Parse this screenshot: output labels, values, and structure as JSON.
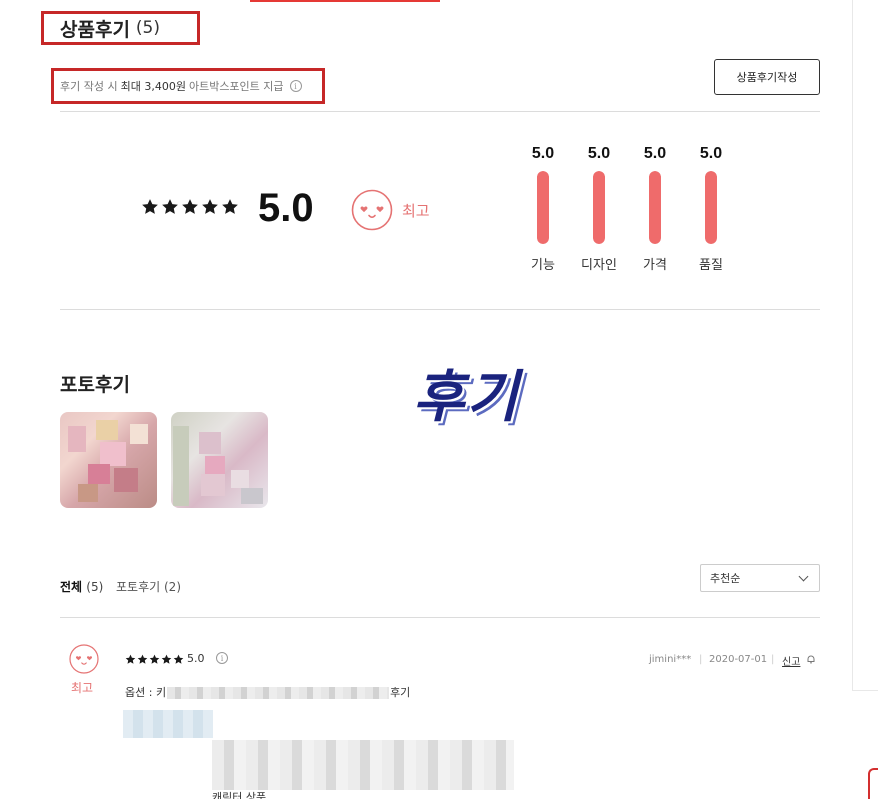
{
  "header": {
    "title": "상품후기",
    "count": "(5)",
    "notice_prefix": "후기 작성 시",
    "notice_strong": "최대 3,400원",
    "notice_suffix": "아트박스포인트 지급",
    "info_icon": "i",
    "write_button": "상품후기작성"
  },
  "summary": {
    "stars": 5,
    "score": "5.0",
    "grade_label": "최고",
    "bars": [
      {
        "label": "기능",
        "value": "5.0",
        "fill": 1.0
      },
      {
        "label": "디자인",
        "value": "5.0",
        "fill": 1.0
      },
      {
        "label": "가격",
        "value": "5.0",
        "fill": 1.0
      },
      {
        "label": "품질",
        "value": "5.0",
        "fill": 1.0
      }
    ]
  },
  "photo_section": {
    "title": "포토후기",
    "watermark": "후기"
  },
  "filter": {
    "tabs": [
      {
        "label": "전체",
        "count": "(5)"
      },
      {
        "label": "포토후기",
        "count": "(2)"
      }
    ],
    "sort_selected": "추천순"
  },
  "review": {
    "grade_label": "최고",
    "stars": 5,
    "score": "5.0",
    "user": "jimini***",
    "date": "2020-07-01",
    "report_label": "신고",
    "option_prefix": "옵션 : 키",
    "option_suffix": "후기",
    "text_cut": "캐릭터 상품 ..."
  },
  "colors": {
    "accent_red": "#e53935",
    "bar_fill": "#ef6b6b",
    "grade_text": "#e57373"
  },
  "icons": [
    "star-icon",
    "smile-face-icon",
    "info-icon",
    "chevron-down-icon",
    "bell-icon"
  ]
}
